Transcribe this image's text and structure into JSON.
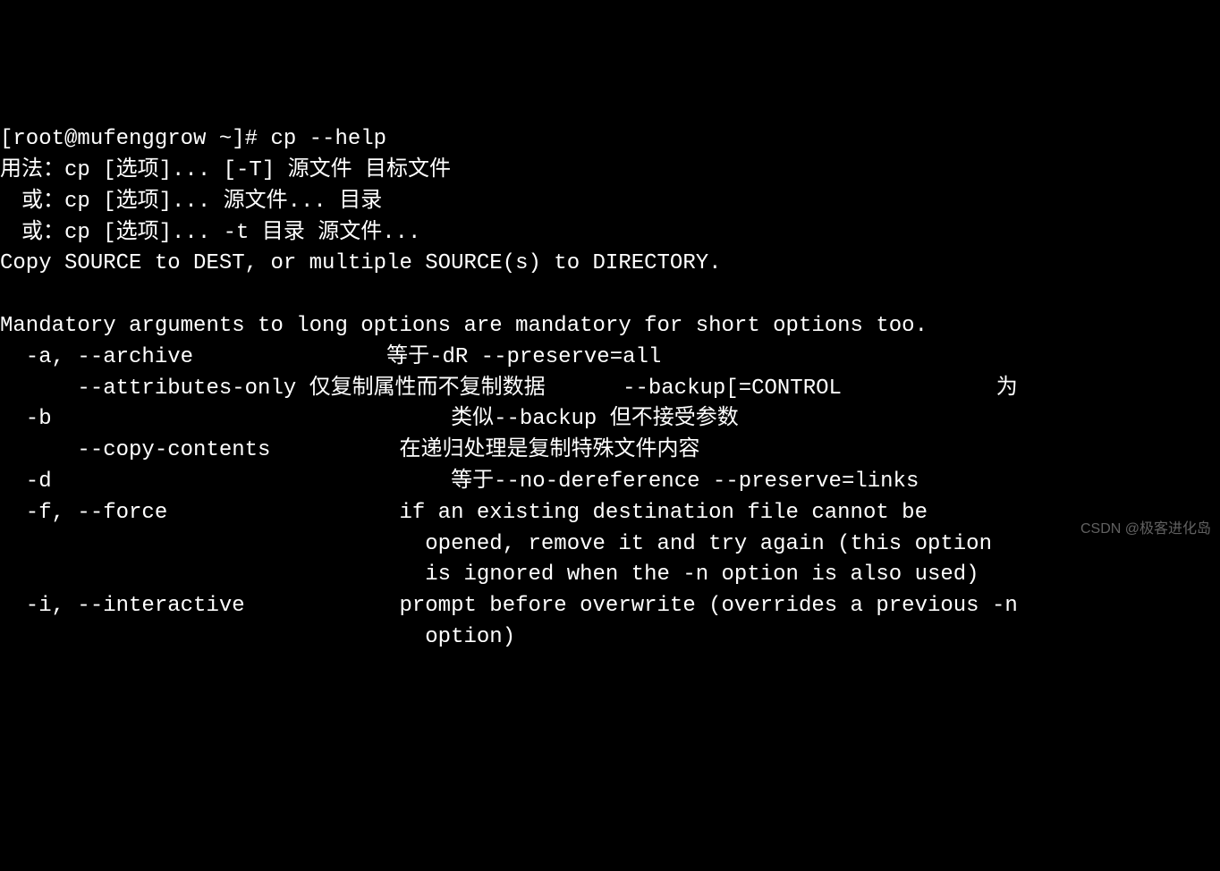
{
  "terminal": {
    "prompt_line": "[root@mufenggrow ~]# cp --help",
    "usage_lines": [
      "用法：cp [选项]... [-T] 源文件 目标文件",
      "　或：cp [选项]... 源文件... 目录",
      "　或：cp [选项]... -t 目录 源文件...",
      "Copy SOURCE to DEST, or multiple SOURCE(s) to DIRECTORY.",
      "",
      "Mandatory arguments to long options are mandatory for short options too."
    ],
    "options": [
      "  -a, --archive               等于-dR --preserve=all",
      "      --attributes-only 仅复制属性而不复制数据      --backup[=CONTROL            为",
      "  -b                               类似--backup 但不接受参数",
      "      --copy-contents          在递归处理是复制特殊文件内容",
      "  -d                               等于--no-dereference --preserve=links",
      "  -f, --force                  if an existing destination file cannot be",
      "                                 opened, remove it and try again (this option",
      "                                 is ignored when the -n option is also used)",
      "  -i, --interactive            prompt before overwrite (overrides a previous -n",
      "                                 option)"
    ]
  },
  "watermark": "CSDN @极客进化岛"
}
